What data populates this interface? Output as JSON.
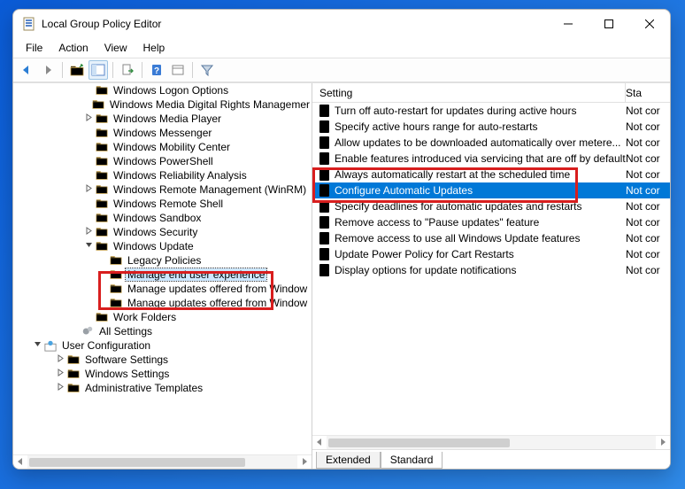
{
  "title": "Local Group Policy Editor",
  "menu": {
    "file": "File",
    "action": "Action",
    "view": "View",
    "help": "Help"
  },
  "columns": {
    "setting": "Setting",
    "state": "Sta"
  },
  "tree": [
    {
      "label": "Windows Logon Options",
      "indent": "i1",
      "exp": ""
    },
    {
      "label": "Windows Media Digital Rights Managemer",
      "indent": "i1",
      "exp": ""
    },
    {
      "label": "Windows Media Player",
      "indent": "i1",
      "exp": ">"
    },
    {
      "label": "Windows Messenger",
      "indent": "i1",
      "exp": ""
    },
    {
      "label": "Windows Mobility Center",
      "indent": "i1",
      "exp": ""
    },
    {
      "label": "Windows PowerShell",
      "indent": "i1",
      "exp": ""
    },
    {
      "label": "Windows Reliability Analysis",
      "indent": "i1",
      "exp": ""
    },
    {
      "label": "Windows Remote Management (WinRM)",
      "indent": "i1",
      "exp": ">"
    },
    {
      "label": "Windows Remote Shell",
      "indent": "i1",
      "exp": ""
    },
    {
      "label": "Windows Sandbox",
      "indent": "i1",
      "exp": ""
    },
    {
      "label": "Windows Security",
      "indent": "i1",
      "exp": ">"
    },
    {
      "label": "Windows Update",
      "indent": "i1",
      "exp": "v"
    },
    {
      "label": "Legacy Policies",
      "indent": "i2",
      "exp": ""
    },
    {
      "label": "Manage end user experience",
      "indent": "i2",
      "exp": "",
      "selected": true
    },
    {
      "label": "Manage updates offered from Window",
      "indent": "i2",
      "exp": ""
    },
    {
      "label": "Manage updates offered from Window",
      "indent": "i2",
      "exp": ""
    },
    {
      "label": "Work Folders",
      "indent": "i1",
      "exp": ""
    },
    {
      "label": "All Settings",
      "indent": "iA",
      "exp": "",
      "icon": "gears"
    },
    {
      "label": "User Configuration",
      "indent": "iU",
      "exp": "v",
      "icon": "user"
    },
    {
      "label": "Software Settings",
      "indent": "iS",
      "exp": ">"
    },
    {
      "label": "Windows Settings",
      "indent": "iS",
      "exp": ">"
    },
    {
      "label": "Administrative Templates",
      "indent": "iS",
      "exp": ">"
    }
  ],
  "settings": [
    {
      "label": "Turn off auto-restart for updates during active hours",
      "state": "Not cor"
    },
    {
      "label": "Specify active hours range for auto-restarts",
      "state": "Not cor"
    },
    {
      "label": "Allow updates to be downloaded automatically over metere...",
      "state": "Not cor"
    },
    {
      "label": "Enable features introduced via servicing that are off by default",
      "state": "Not cor"
    },
    {
      "label": "Always automatically restart at the scheduled time",
      "state": "Not cor"
    },
    {
      "label": "Configure Automatic Updates",
      "state": "Not cor",
      "selected": true
    },
    {
      "label": "Specify deadlines for automatic updates and restarts",
      "state": "Not cor"
    },
    {
      "label": "Remove access to \"Pause updates\" feature",
      "state": "Not cor"
    },
    {
      "label": "Remove access to use all Windows Update features",
      "state": "Not cor"
    },
    {
      "label": "Update Power Policy for Cart Restarts",
      "state": "Not cor"
    },
    {
      "label": "Display options for update notifications",
      "state": "Not cor"
    }
  ],
  "tabs": {
    "extended": "Extended",
    "standard": "Standard"
  },
  "highlights": {
    "tree_box": "tree-items 12..15",
    "list_box": "settings row 5 (Configure Automatic Updates)"
  }
}
